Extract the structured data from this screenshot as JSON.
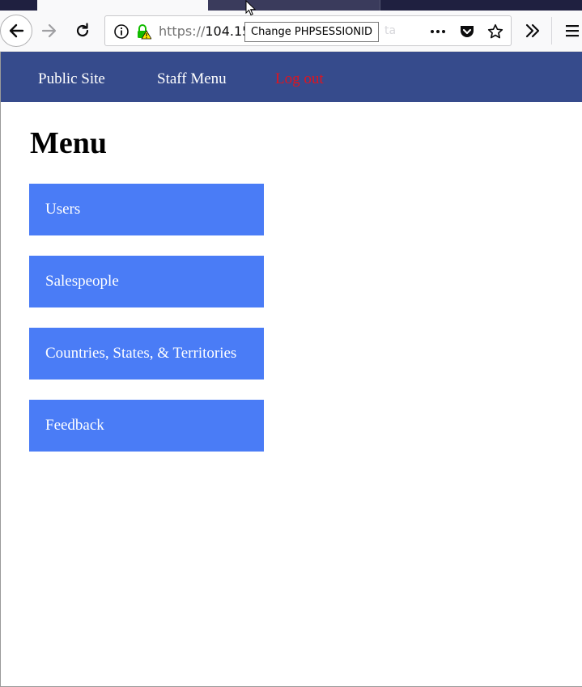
{
  "browser": {
    "url_scheme": "https://",
    "url_host": "104.15",
    "url_fade": "ta",
    "tooltip": "Change PHPSESSIONID",
    "icons": {
      "back": "back-arrow-icon",
      "forward": "forward-arrow-icon",
      "reload": "reload-icon",
      "info": "info-icon",
      "lock": "lock-warning-icon",
      "page_actions": "ellipsis-icon",
      "pocket": "pocket-icon",
      "bookmark": "star-icon",
      "overflow": "chevron-double-right-icon",
      "menu": "hamburger-menu-icon"
    }
  },
  "nav": {
    "public_site": "Public Site",
    "staff_menu": "Staff Menu",
    "log_out": "Log out"
  },
  "page": {
    "title": "Menu",
    "menu_items": [
      "Users",
      "Salespeople",
      "Countries, States, & Territories",
      "Feedback"
    ]
  },
  "colors": {
    "navbar": "#364b8c",
    "menu_button": "#4a7cf6",
    "logout_link": "#e0141e",
    "tab_strip": "#1f2040"
  }
}
